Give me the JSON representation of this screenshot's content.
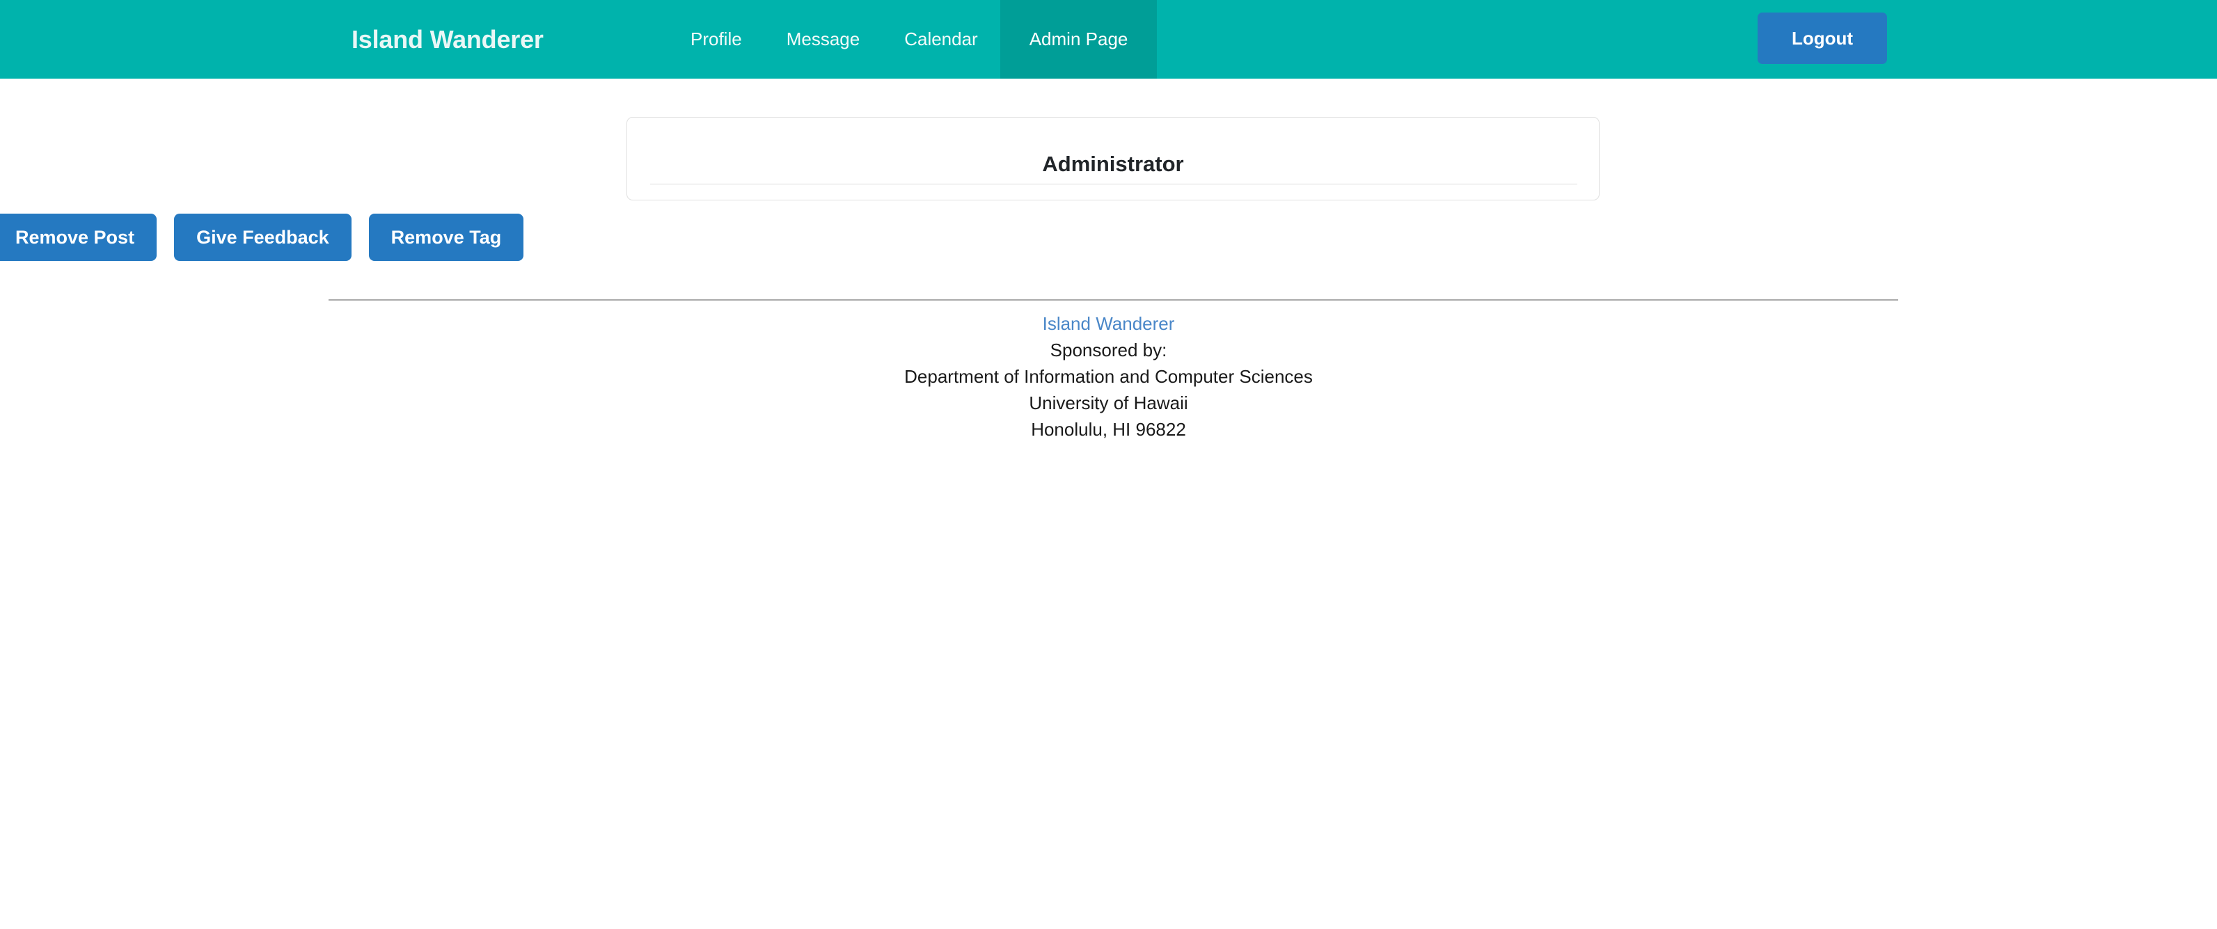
{
  "navbar": {
    "brand": "Island Wanderer",
    "links": [
      {
        "label": "Profile",
        "active": false
      },
      {
        "label": "Message",
        "active": false
      },
      {
        "label": "Calendar",
        "active": false
      },
      {
        "label": "Admin Page",
        "active": true
      }
    ],
    "logout_label": "Logout",
    "background_color": "#00b3ac",
    "active_tab_color": "#009e97",
    "button_color": "#2579c1"
  },
  "main": {
    "card": {
      "title": "Administrator"
    },
    "actions": [
      {
        "label": "Remove Post"
      },
      {
        "label": "Give Feedback"
      },
      {
        "label": "Remove Tag"
      }
    ]
  },
  "footer": {
    "link": "Island Wanderer",
    "link_color": "#4a87c8",
    "lines": [
      "Sponsored by:",
      "Department of Information and Computer Sciences",
      "University of Hawaii",
      "Honolulu, HI 96822"
    ]
  }
}
